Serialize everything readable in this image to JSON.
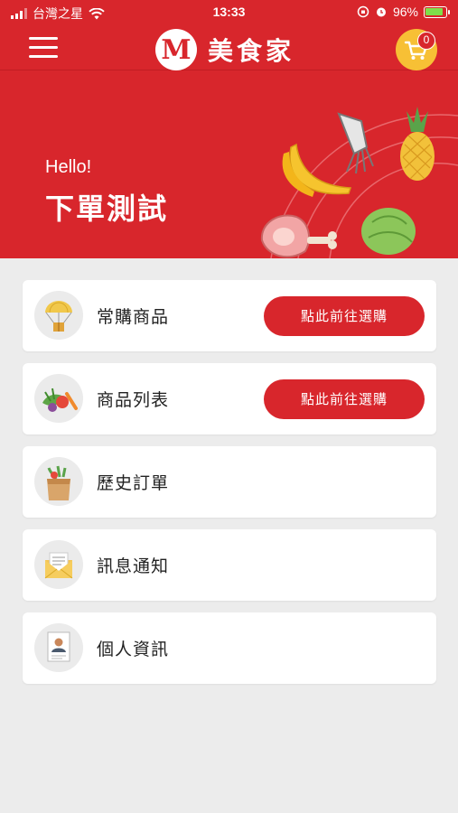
{
  "status_bar": {
    "carrier": "台灣之星",
    "time": "13:33",
    "battery": "96%",
    "battery_level": 0.96
  },
  "header": {
    "logo_letter": "M",
    "logo_text": "美食家",
    "cart_count": "0",
    "icons": {
      "menu": "hamburger-menu-icon",
      "cart": "shopping-cart-icon"
    }
  },
  "hero": {
    "greeting": "Hello!",
    "username": "下單測試"
  },
  "menu": [
    {
      "label": "常購商品",
      "action": "點此前往選購",
      "icon": "parachute-gift-icon"
    },
    {
      "label": "商品列表",
      "action": "點此前往選購",
      "icon": "vegetables-icon"
    },
    {
      "label": "歷史訂單",
      "action": "",
      "icon": "grocery-bag-icon"
    },
    {
      "label": "訊息通知",
      "action": "",
      "icon": "envelope-icon"
    },
    {
      "label": "個人資訊",
      "action": "",
      "icon": "profile-document-icon"
    }
  ],
  "colors": {
    "brand_red": "#d8262c",
    "cart_yellow": "#f7c035",
    "background": "#ececec"
  }
}
